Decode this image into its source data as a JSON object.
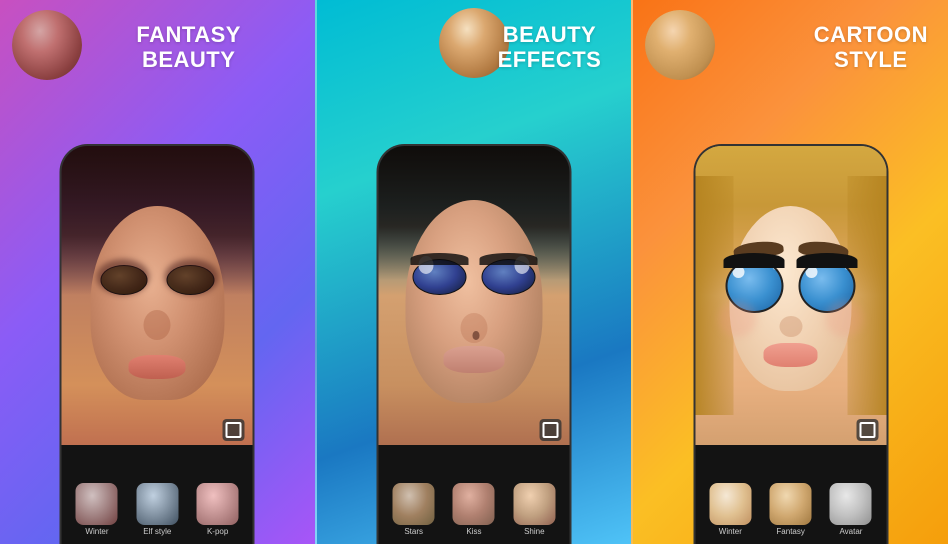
{
  "panels": [
    {
      "id": "fantasy",
      "title_line1": "FANTASY",
      "title_line2": "BEAUTY",
      "gradient": "fantasy",
      "filters": [
        {
          "id": "winter",
          "label": "Winter",
          "class": "ft-winter"
        },
        {
          "id": "elf",
          "label": "Elf style",
          "class": "ft-elf"
        },
        {
          "id": "kpop",
          "label": "K-pop",
          "class": "ft-kpop"
        }
      ]
    },
    {
      "id": "beauty",
      "title_line1": "BEAUTY",
      "title_line2": "EFFECTS",
      "gradient": "beauty",
      "filters": [
        {
          "id": "stars",
          "label": "Stars",
          "class": "ft-stars"
        },
        {
          "id": "kiss",
          "label": "Kiss",
          "class": "ft-kiss"
        },
        {
          "id": "shine",
          "label": "Shine",
          "class": "ft-shine"
        }
      ]
    },
    {
      "id": "cartoon",
      "title_line1": "CARTOON",
      "title_line2": "STYLE",
      "gradient": "cartoon",
      "filters": [
        {
          "id": "winter2",
          "label": "Winter",
          "class": "ft-winter2"
        },
        {
          "id": "fantasy",
          "label": "Fantasy",
          "class": "ft-fantasy"
        },
        {
          "id": "avatar",
          "label": "Avatar",
          "class": "ft-avatar"
        }
      ]
    }
  ]
}
